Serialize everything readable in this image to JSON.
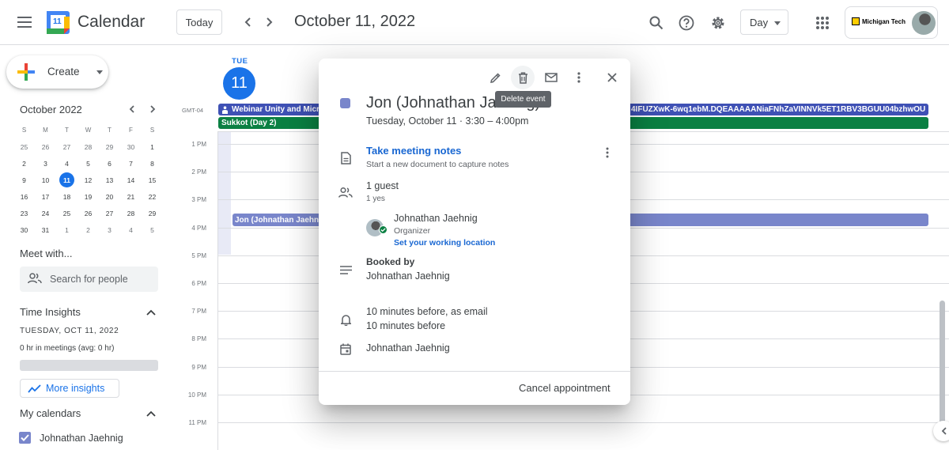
{
  "header": {
    "app_title": "Calendar",
    "logo_number": "11",
    "today_label": "Today",
    "date_title": "October 11, 2022",
    "view_label": "Day",
    "account_org": "Michigan Tech"
  },
  "sidebar": {
    "create_label": "Create",
    "mini_calendar": {
      "title": "October 2022",
      "weekdays": [
        "S",
        "M",
        "T",
        "W",
        "T",
        "F",
        "S"
      ],
      "weeks": [
        [
          "25",
          "26",
          "27",
          "28",
          "29",
          "30",
          "1"
        ],
        [
          "2",
          "3",
          "4",
          "5",
          "6",
          "7",
          "8"
        ],
        [
          "9",
          "10",
          "11",
          "12",
          "13",
          "14",
          "15"
        ],
        [
          "16",
          "17",
          "18",
          "19",
          "20",
          "21",
          "22"
        ],
        [
          "23",
          "24",
          "25",
          "26",
          "27",
          "28",
          "29"
        ],
        [
          "30",
          "31",
          "1",
          "2",
          "3",
          "4",
          "5"
        ]
      ],
      "today": "11"
    },
    "meet_with_title": "Meet with...",
    "search_people_placeholder": "Search for people",
    "time_insights_title": "Time Insights",
    "time_insights_date": "TUESDAY, OCT 11, 2022",
    "time_insights_meetings": "0 hr in meetings (avg: 0 hr)",
    "more_insights_label": "More insights",
    "my_calendars_title": "My calendars",
    "calendar_name": "Johnathan Jaehnig"
  },
  "day_view": {
    "day_abbrev": "TUE",
    "day_number": "11",
    "timezone": "GMT-04",
    "allday_events": [
      {
        "title": "Webinar Unity and Micr",
        "suffix": "4IFUZXwK-6wq1ebM.DQEAAAAANiaFNhZaVINNVk5ET1RBV3BGUU04bzhwOU",
        "color": "#3f51b5"
      },
      {
        "title": "Sukkot (Day 2)",
        "color": "#0b8043"
      }
    ],
    "hours": [
      "1 PM",
      "2 PM",
      "3 PM",
      "4 PM",
      "5 PM",
      "6 PM",
      "7 PM",
      "8 PM",
      "9 PM",
      "10 PM",
      "11 PM"
    ],
    "timed_event": {
      "title": "Jon (Johnathan Jaehn",
      "color": "#7986cb"
    }
  },
  "popup": {
    "tooltip": "Delete event",
    "title": "Jon (Johnathan Jaehnig)",
    "time": "Tuesday, October 11  ·  3:30 – 4:00pm",
    "notes_title": "Take meeting notes",
    "notes_sub": "Start a new document to capture notes",
    "guest_count": "1 guest",
    "guest_status": "1 yes",
    "guest_name": "Johnathan Jaehnig",
    "guest_role": "Organizer",
    "guest_location_link": "Set your working location",
    "booked_by_label": "Booked by",
    "booked_by_name": "Johnathan Jaehnig",
    "reminders": [
      "10 minutes before, as email",
      "10 minutes before"
    ],
    "owner": "Johnathan Jaehnig",
    "cancel_label": "Cancel appointment"
  },
  "colors": {
    "accent": "#1a73e8",
    "event_purple": "#7986cb",
    "webinar_blue": "#3f51b5",
    "holiday_green": "#0b8043"
  }
}
